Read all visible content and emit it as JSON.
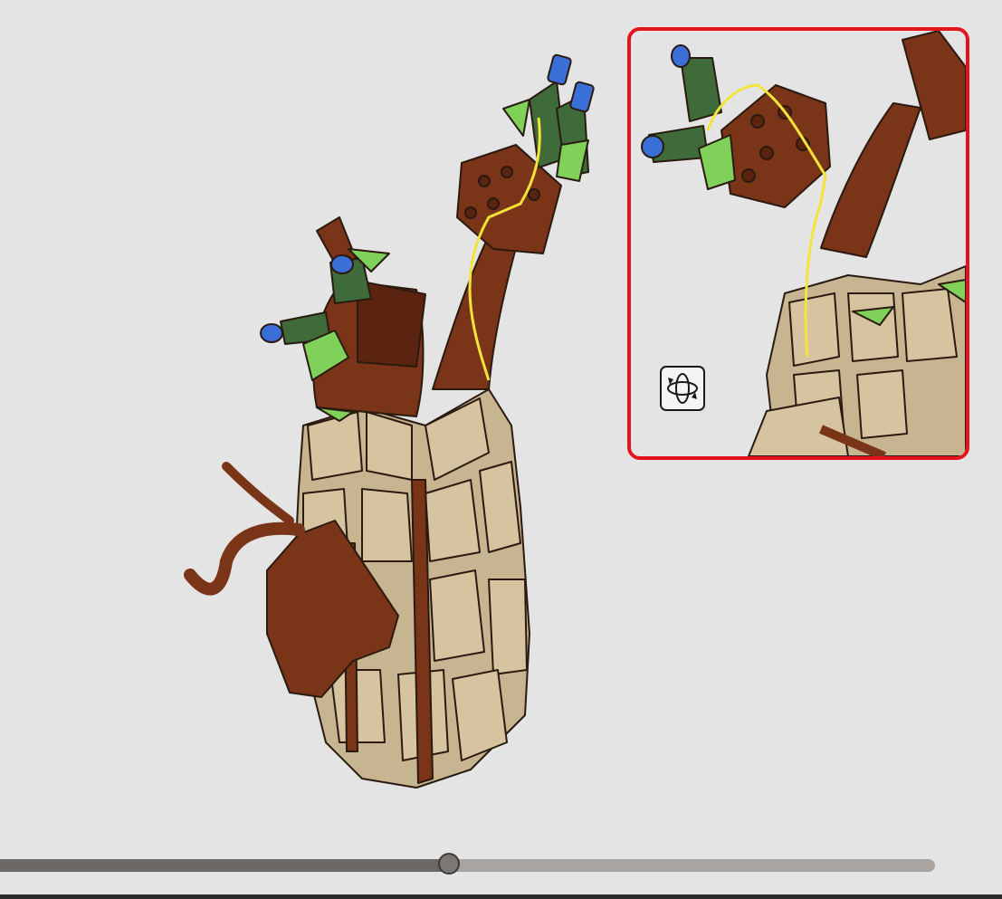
{
  "viewer": {
    "accent_color": "#e3141b",
    "brick_colors": {
      "reddish_brown": "#7a3418",
      "tan": "#c7b491",
      "dark_green": "#3f6b3a",
      "bright_green": "#7fd15a",
      "blue": "#3a6fd8",
      "highlight": "#f3e33a"
    }
  },
  "callout": {
    "icon": "rotate-model-icon"
  },
  "progress": {
    "value": 0.48
  }
}
